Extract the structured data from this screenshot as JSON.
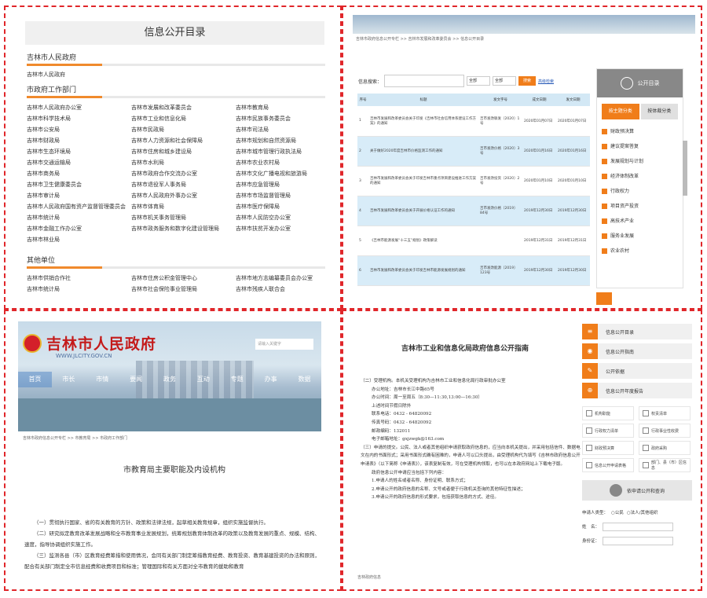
{
  "q1": {
    "title": "信息公开目录",
    "gov": {
      "head": "吉林市人民政府",
      "item": "吉林市人民政府"
    },
    "depts": {
      "head": "市政府工作部门",
      "items": [
        "吉林市人民政府办公室",
        "吉林市发展和改革委员会",
        "吉林市教育局",
        "吉林市科学技术局",
        "吉林市工业和信息化局",
        "吉林市民族事务委员会",
        "吉林市公安局",
        "吉林市民政局",
        "吉林市司法局",
        "吉林市财政局",
        "吉林市人力资源和社会保障局",
        "吉林市规划和自然资源局",
        "吉林市生态环境局",
        "吉林市住房和城乡建设局",
        "吉林市城市管理行政执法局",
        "吉林市交通运输局",
        "吉林市水利局",
        "吉林市农业农村局",
        "吉林市商务局",
        "吉林市政府合作交流办公室",
        "吉林市文化广播电视和旅游局",
        "吉林市卫生健康委员会",
        "吉林市退役军人事务局",
        "吉林市应急管理局",
        "吉林市审计局",
        "吉林市人民政府外事办公室",
        "吉林市市场监督管理局",
        "吉林市人民政府国有资产监督管理委员会",
        "吉林市体育局",
        "吉林市医疗保障局",
        "吉林市统计局",
        "吉林市机关事务管理局",
        "吉林市人民防空办公室",
        "吉林市金融工作办公室",
        "吉林市政务服务和数字化建设管理局",
        "吉林市扶贫开发办公室",
        "吉林市林业局",
        "",
        ""
      ]
    },
    "other": {
      "head": "其他单位",
      "items": [
        "吉林市供销合作社",
        "吉林市住房公积金管理中心",
        "吉林市地方志编纂委员会办公室",
        "吉林市统计局",
        "吉林市社会保险事业管理局",
        "吉林市残疾人联合会"
      ]
    }
  },
  "q2": {
    "crumb": "吉林市政府信息公开专栏 >> 吉林市发展和改革委员会 >> 信息公开目录",
    "search_label": "信息搜索：",
    "sel1": "全部",
    "sel2": "全部",
    "search_btn": "搜索",
    "adv": "高级检索",
    "cols": [
      "序号",
      "标题",
      "发文字号",
      "成文日期",
      "发文日期"
    ],
    "rows": [
      {
        "n": "1",
        "title": "吉林市发展和改革委员会关于印发《吉林市社会信用体系建设工作方案》的通知",
        "no": "吉市发改联发〔2020〕1号",
        "d1": "2020年01月07日",
        "d2": "2020年01月07日"
      },
      {
        "n": "2",
        "title": "关于做好2020年度吉林市价格监测工作的通知",
        "no": "吉市发改价格〔2020〕3号",
        "d1": "2020年01月16日",
        "d2": "2020年01月16日"
      },
      {
        "n": "3",
        "title": "吉林市发展和改革委员会关于印发吉林市重点项目建设推进工作方案的通知",
        "no": "吉市发改投资〔2020〕2号",
        "d1": "2020年01月10日",
        "d2": "2020年01月10日"
      },
      {
        "n": "4",
        "title": "吉林市发展和改革委员会关于开展价格认证工作的通知",
        "no": "吉市发改价格〔2019〕84号",
        "d1": "2019年12月30日",
        "d2": "2019年12月30日"
      },
      {
        "n": "5",
        "title": "《吉林市能源发展“十三五”规划》政策解读",
        "no": "",
        "d1": "2019年12月31日",
        "d2": "2019年12月31日"
      },
      {
        "n": "6",
        "title": "吉林市发展和改革委员会关于印发吉林市能源发展规划的通知",
        "no": "吉市发改能源〔2019〕123号",
        "d1": "2019年12月30日",
        "d2": "2019年12月30日"
      }
    ],
    "side": {
      "head": "公开目录",
      "tab_on": "按主题分类",
      "tab_off": "按体裁分类",
      "items": [
        "财政预决算",
        "建议提案答复",
        "发展规划与计划",
        "经济体制改革",
        "行政权力",
        "项目资产投资",
        "高技术产业",
        "服务业发展",
        "农业农村"
      ]
    }
  },
  "q3": {
    "logo": "吉林市人民政府",
    "url": "WWW.JLCITY.GOV.CN",
    "search_ph": "请输入关键字",
    "nav": [
      "首页",
      "市长",
      "市情",
      "要闻",
      "政务",
      "互动",
      "专题",
      "办事",
      "数据"
    ],
    "crumb": "吉林市政府信息公开专栏 >> 市教育局 >> 市政府工作部门",
    "heading": "市教育局主要职能及内设机构",
    "paras": [
      "（一）贯彻执行国家、省的有关教育的方针、政策和法律法规，起草相关教育规章，组织实施监督执行。",
      "（二）研究拟定教育改革发展战略和全市教育事业发展规划，统筹规划教育体制改革的政策以及教育发展的重点、规模、结构、速度，指导协调组织实施工作。",
      "（三）监测各县（市）区教育经费筹措和使用情况，会同有关部门制定筹措教育经费、教育投资、教育基建投资的办法和原则，配合有关部门制定全市信息经费和收费项目和标准；管理国际和有关方面对全市教育的援助和教育"
    ]
  },
  "q4": {
    "heading": "吉林市工业和信息化局政府信息公开指南",
    "lines": [
      {
        "t": "（二）受理机构。本机关受理机构为吉林市工业和信息化局行政审批办公室",
        "i": false
      },
      {
        "t": "办公地址：吉林市长江中路65号",
        "i": true
      },
      {
        "t": "办公时间：周一至周五（8:30—11:30,13:00—16:30）",
        "i": true
      },
      {
        "t": "上述时间节假日除外",
        "i": true
      },
      {
        "t": "联系电话：0432 - 64820092",
        "i": true
      },
      {
        "t": "传真号码：0432 - 64820092",
        "i": true
      },
      {
        "t": "邮政编码：132011",
        "i": true
      },
      {
        "t": "电子邮箱地址：gxjzwgk@163.com",
        "i": true
      },
      {
        "t": "（三）申请的提交。公民、法人或者其他组织申请获取政府信息的，应当向本机关提出，并采用包括信件、数据电文在内的书面形式；采用书面形式确有困难的，申请人可以口头提出，由受理机构代为填写《吉林市政府信息公开申请表》（以下简称《申请表》），该表复制有效，可在受理机构领取，也可以在本政府网站上下载电子版。",
        "i": false
      },
      {
        "t": "政府信息公开申请应当包括下列内容：",
        "i": true
      },
      {
        "t": "1.申请人的姓名或者名称、身份证明、联系方式；",
        "i": true
      },
      {
        "t": "2.申请公开的政府信息的名称、文号或者便于行政机关查询的其他特征性描述；",
        "i": true
      },
      {
        "t": "3.申请公开的政府信息的形式要求，包括获取信息的方式、途径。",
        "i": true
      }
    ],
    "foot": "吉林政府信息",
    "side_btns": [
      "信息公开目录",
      "信息公开指南",
      "公开依据",
      "信息公开年度报告"
    ],
    "grid": [
      "机构职能",
      "权责清单",
      "行政权力清单",
      "行政事业性收费",
      "财政预决算",
      "政府采购",
      "信息公开申请表格",
      "部门、县（市）区信息"
    ],
    "apply": "依申请公开和查询",
    "form": {
      "type_label": "申请人类型：",
      "opt1": "公民",
      "opt2": "法人/其他组织",
      "name_label": "姓　名：",
      "id_label": "身份证："
    }
  }
}
